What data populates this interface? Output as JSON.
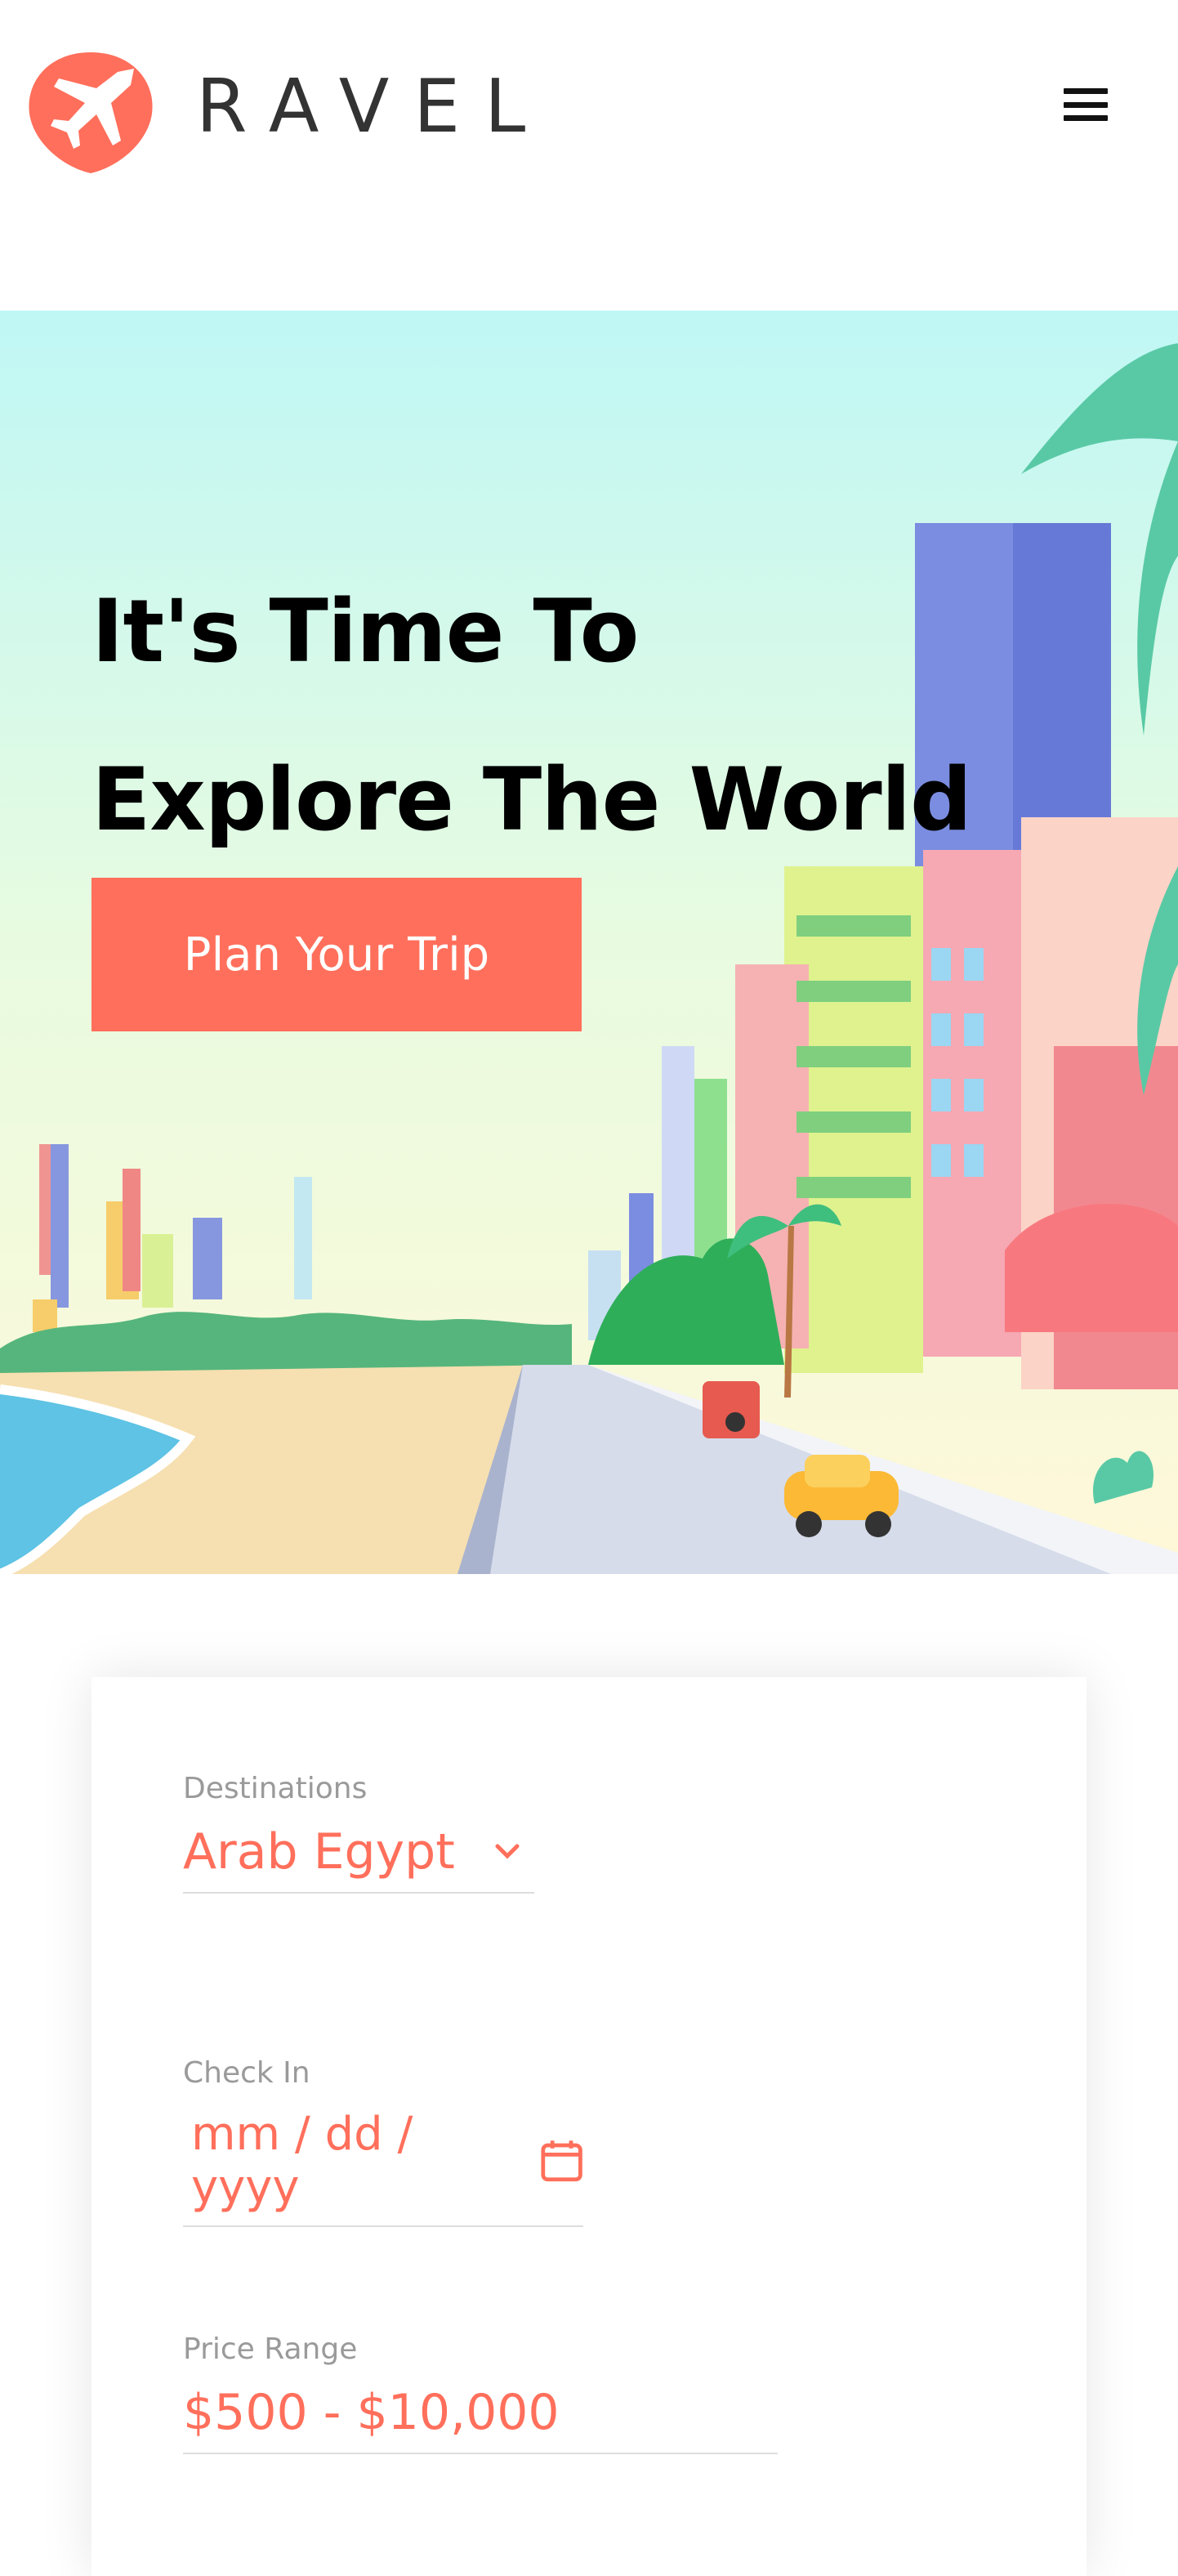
{
  "brand": {
    "name": "RAVEL",
    "accent": "#ff6f5b",
    "text_color": "#333333"
  },
  "header": {
    "menu_icon": "hamburger-menu-icon"
  },
  "hero": {
    "title_line1": "It's Time To",
    "title_line2": "Explore The World",
    "cta_label": "Plan Your Trip",
    "illustration": "beach-city-street-illustration"
  },
  "form": {
    "destination": {
      "label": "Destinations",
      "value": "Arab Egypt",
      "icon": "chevron-down-icon"
    },
    "check_in": {
      "label": "Check In",
      "placeholder": "mm / dd / yyyy",
      "icon": "calendar-icon"
    },
    "price_range": {
      "label": "Price Range",
      "value": "$500 - $10,000"
    }
  }
}
